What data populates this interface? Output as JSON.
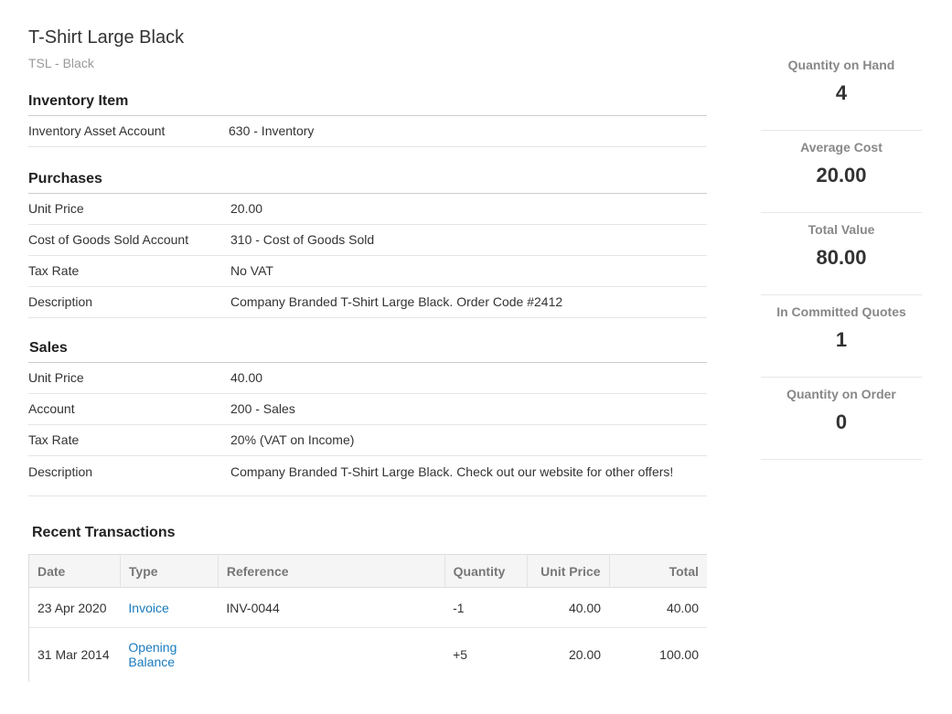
{
  "item": {
    "name": "T-Shirt Large Black",
    "code": "TSL - Black"
  },
  "inventory": {
    "heading": "Inventory Item",
    "rows": [
      {
        "label": "Inventory Asset Account",
        "value": "630 - Inventory"
      }
    ]
  },
  "purchases": {
    "heading": "Purchases",
    "rows": [
      {
        "label": "Unit Price",
        "value": "20.00"
      },
      {
        "label": "Cost of Goods Sold Account",
        "value": "310 - Cost of Goods Sold"
      },
      {
        "label": "Tax Rate",
        "value": "No VAT"
      },
      {
        "label": "Description",
        "value": "Company Branded T-Shirt Large Black. Order Code #2412"
      }
    ]
  },
  "sales": {
    "heading": "Sales",
    "rows": [
      {
        "label": "Unit Price",
        "value": "40.00"
      },
      {
        "label": "Account",
        "value": "200 - Sales"
      },
      {
        "label": "Tax Rate",
        "value": "20% (VAT on Income)"
      },
      {
        "label": "Description",
        "value": "Company Branded T-Shirt Large Black. Check out our website for other offers!"
      }
    ]
  },
  "transactions": {
    "heading": "Recent Transactions",
    "columns": [
      "Date",
      "Type",
      "Reference",
      "Quantity",
      "Unit Price",
      "Total"
    ],
    "rows": [
      {
        "date": "23 Apr 2020",
        "type": "Invoice",
        "reference": "INV-0044",
        "quantity": "-1",
        "unit_price": "40.00",
        "total": "40.00"
      },
      {
        "date": "31 Mar 2014",
        "type_line1": "Opening",
        "type_line2": "Balance",
        "reference": "",
        "quantity": "+5",
        "unit_price": "20.00",
        "total": "100.00"
      }
    ]
  },
  "stats": [
    {
      "label": "Quantity on Hand",
      "value": "4"
    },
    {
      "label": "Average Cost",
      "value": "20.00"
    },
    {
      "label": "Total Value",
      "value": "80.00"
    },
    {
      "label": "In Committed Quotes",
      "value": "1"
    },
    {
      "label": "Quantity on Order",
      "value": "0"
    }
  ],
  "colors": {
    "link": "#1a7bbf",
    "muted": "#999999",
    "heading": "#222222"
  }
}
